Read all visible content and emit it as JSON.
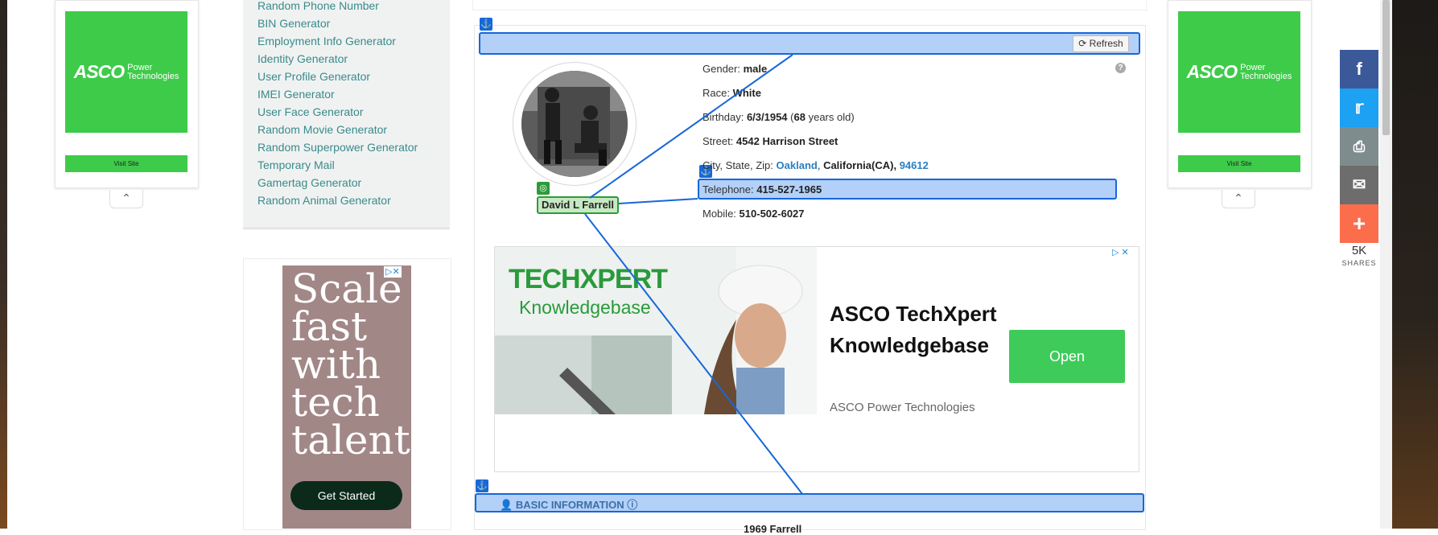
{
  "left_links": [
    "Random Phone Number",
    "BIN Generator",
    "Employment Info Generator",
    "Identity Generator",
    "User Profile Generator",
    "IMEI Generator",
    "User Face Generator",
    "Random Movie Generator",
    "Random Superpower Generator",
    "Temporary Mail",
    "Gamertag Generator",
    "Random Animal Generator"
  ],
  "side_ad": {
    "brand": "ASCO",
    "sub_line1": "Power",
    "sub_line2": "Technologies",
    "visit": "Visit Site"
  },
  "tall_ad": {
    "headline": "Scale fast with tech talent",
    "cta": "Get Started"
  },
  "refresh_label": "Refresh",
  "person": {
    "name": "David L Farrell",
    "gender_label": "Gender:",
    "gender": "male",
    "race_label": "Race:",
    "race": "White",
    "birthday_label": "Birthday:",
    "birthday": "6/3/1954",
    "age": "68",
    "age_suffix": "years old)",
    "street_label": "Street:",
    "street": "4542 Harrison Street",
    "csz_label": "City, State, Zip:",
    "city": "Oakland",
    "state": "California(CA),",
    "zip": "94612",
    "telephone_label": "Telephone:",
    "telephone": "415-527-1965",
    "mobile_label": "Mobile:",
    "mobile": "510-502-6027"
  },
  "banner_ad": {
    "logo": "TECHXPERT",
    "logo_sub": "Knowledgebase",
    "headline": "ASCO TechXpert Knowledgebase",
    "advertiser": "ASCO Power Technologies",
    "cta": "Open"
  },
  "section_label": "BASIC INFORMATION",
  "below_text": "1969 Farrell",
  "share": {
    "count": "5K",
    "label": "SHARES"
  },
  "colors": {
    "facebook": "#3b5998",
    "twitter": "#1da1f2",
    "print": "#7f8c8d",
    "email": "#6d6d6d",
    "more": "#fc6d4c",
    "highlight": "#1767d9"
  }
}
